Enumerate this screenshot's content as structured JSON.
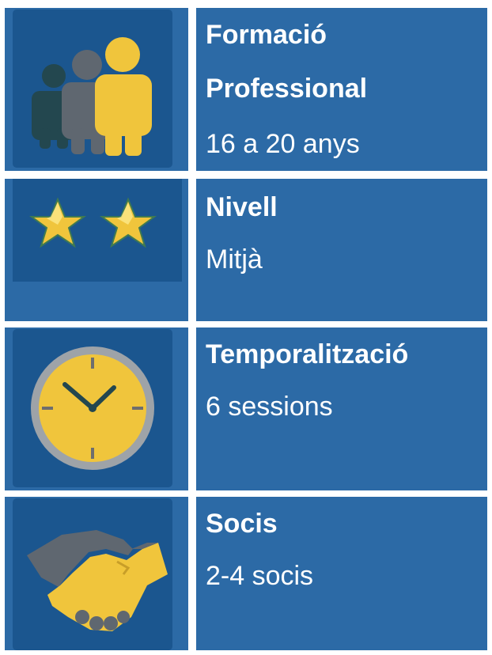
{
  "cards": [
    {
      "title_line1": "Formació",
      "title_line2": "Professional",
      "value": "16 a 20 anys",
      "icon": "people-group-icon"
    },
    {
      "title": "Nivell",
      "value": "Mitjà",
      "icon": "two-stars-icon",
      "rating": {
        "filled": 2
      }
    },
    {
      "title": "Temporalització",
      "value": "6 sessions",
      "icon": "clock-icon"
    },
    {
      "title": "Socis",
      "value": "2-4 socis",
      "icon": "handshake-icon"
    }
  ],
  "colors": {
    "panel": "#2c6aa6",
    "tile": "#1b568f",
    "accent_yellow": "#f0c53c",
    "gray": "#5f6770",
    "dark": "#23474f"
  }
}
